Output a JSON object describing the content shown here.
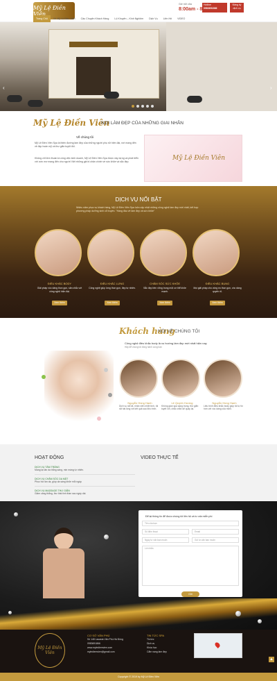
{
  "brand": {
    "logo_text": "Mỹ Lệ Điền Viên",
    "accent": "#c39a3e",
    "red": "#c0392b"
  },
  "header": {
    "nav": [
      "Trang Chủ",
      "Về Mỹ Lệ Điền Viên",
      "Câu Chuyện Khách Hàng",
      "Lộ Khuyên – Kinh Nghiệm",
      "Dịch Vụ",
      "Liên Hệ",
      "VIDEO"
    ],
    "hotline_label": "Giờ mở cửa",
    "hours": "8:00am - 8:00pm",
    "phone_label": "Hotline",
    "phone": "0983691866",
    "register_label": "Đăng ký dịch vụ"
  },
  "intro": {
    "title": "Mỹ Lệ Điền Viên",
    "subtitle": "NƠI LÀM ĐẸP CỦA NHỮNG GIAI NHÂN",
    "about_label": "Về chúng tôi",
    "p1": "Mỹ Lệ Điền Viên Spa là thiên đường làm đẹp của những người phụ nữ hiện đại, nơi mang đến vẻ đẹp hoàn mỹ và thư giãn tuyệt đối.",
    "p2": "Không chỉ đơn thuần là công việc kinh doanh, Mỹ Lệ Điền Viên Spa được xây dựng và phát triển với ước mơ mang đến cho người Việt những giá trị chân chính về sức khỏe và sắc đẹp.",
    "image_text": "Mỹ Lệ Điền Viên"
  },
  "services": {
    "title": "DỊCH VỤ NỔI BẬT",
    "desc": "Nhiều năm phục vụ khách hàng, Mỹ Lệ Điền Viên Spa luôn cập nhật những công nghệ làm đẹp mới nhất, kết hợp phương pháp dưỡng sinh cổ truyền. \"Hàng đầu về làm đẹp và sức khỏe\"",
    "button": "Xem thêm",
    "items": [
      {
        "name": "ĐIỀU KHẮC BODY",
        "text": "Giải pháp vóc dáng thon gọn, săn chắc với công nghệ hiện đại."
      },
      {
        "name": "ĐIỀU KHẮC LƯNG",
        "text": "Công nghệ giúp lưng thon gọn, đẹp tự nhiên."
      },
      {
        "name": "CHĂM SÓC SỨC KHỎE",
        "text": "Sắc đẹp bền vững trong một cơ thể khỏe mạnh."
      },
      {
        "name": "ĐIỀU KHẮC BỤNG",
        "text": "Mọi giải pháp cho vòng eo thon gọn, vóc dáng quyến rũ."
      }
    ]
  },
  "testimonials": {
    "title": "Khách hàng",
    "subtitle": "NÓI VỀ CHÚNG TÔI",
    "desc": "Công nghệ điều khắc body là xu hướng làm đẹp mới nhất hiện nay",
    "desc2": "Hãy để chúng tôi đồng hành cùng bạn",
    "items": [
      {
        "name": "Nguyễn Hồng Hạnh",
        "text": "Dịch vụ rất tốt, nhân viên nhiệt tình, tôi rất hài lòng với kết quả sau liệu trình."
      },
      {
        "name": "Lê Quỳnh Hương",
        "text": "Không gian spa sang trọng, thư giãn tuyệt vời, chắc chắn sẽ quay lại."
      },
      {
        "name": "Nguyễn Hồng Hạnh",
        "text": "Liệu trình điều khắc body giúp tôi tự tin hơn với vóc dáng của mình."
      }
    ]
  },
  "news": {
    "title": "HOẠT ĐỘNG",
    "video_title": "VIDEO THỰC TẾ",
    "items": [
      {
        "label": "DỊCH VỤ TẮM TRẮNG",
        "text": "Mang lại làn da trắng sáng, mịn màng tự nhiên."
      },
      {
        "label": "DỊCH VỤ CHĂM SÓC DA MẶT",
        "text": "Phục hồi làn da, giúp da sáng khỏe mỗi ngày."
      },
      {
        "label": "DỊCH VỤ MASSAGE THƯ GIÃN",
        "text": "Giảm căng thẳng, thư thái tinh thần sau ngày dài."
      }
    ]
  },
  "form": {
    "title": "Để lại thông tin để được chúng tôi liên hệ và tư vấn miễn phí",
    "name": "Tên của bạn",
    "phone": "Số điện thoại",
    "email": "Email",
    "date": "Ngày tư vấn bạn muốn",
    "service": "Gói tư vấn bạn muốn",
    "msg": "Lời nhắn",
    "submit": "Gửi"
  },
  "footer": {
    "logo": "Mỹ Lệ Điền Viên",
    "col1_title": "CƠ SỞ VĂN PHÚ",
    "address": "Số 148 Lacasta Văn Phú Hà Đông",
    "phone": "0983691866",
    "web": "www.mylediemvien.com",
    "email": "mylediemvien@gmail.com",
    "col2_title": "TIN TỨC SPA",
    "links": [
      "Tin tức",
      "Dịch vụ",
      "Khóa học",
      "Cẩm nang làm đẹp"
    ],
    "copyright": "Copyright © 2019 by Mỹ Lệ Điền Viên"
  }
}
